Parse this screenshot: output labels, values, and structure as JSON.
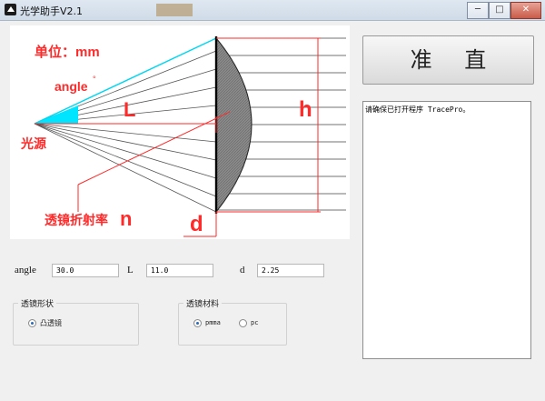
{
  "window": {
    "title": "光学助手V2.1",
    "controls": [
      "─",
      "□",
      "✕"
    ]
  },
  "diagram": {
    "unit_label": "单位：mm",
    "angle_label": "angle",
    "angle_unit": "°",
    "L_label": "L",
    "h_label": "h",
    "source_label": "光源",
    "lens_index_label": "透镜折射率",
    "n_label": "n",
    "d_label": "d",
    "colors": {
      "cyan": "#00e5ff",
      "red": "#ff2a2a",
      "grey": "#777777"
    }
  },
  "collimate_button": "准 直",
  "log_text": "请确保已打开程序 TracePro。",
  "params": {
    "angle": {
      "label": "angle",
      "value": "30.0"
    },
    "L": {
      "label": "L",
      "value": "11.0"
    },
    "d": {
      "label": "d",
      "value": "2.25"
    }
  },
  "lens_shape": {
    "title": "透镜形状",
    "options": [
      {
        "label": "凸透镜",
        "checked": true
      }
    ]
  },
  "lens_material": {
    "title": "透镜材料",
    "options": [
      {
        "label": "pmma",
        "checked": true
      },
      {
        "label": "pc",
        "checked": false
      }
    ]
  }
}
